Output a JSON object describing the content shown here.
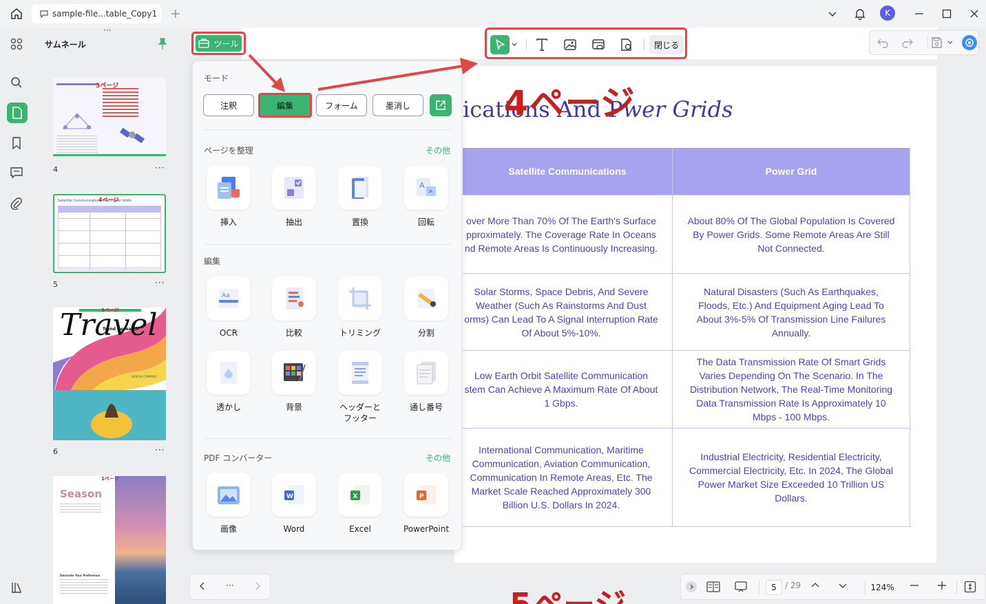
{
  "window": {
    "tab_title": "sample-file...table_Copy1",
    "avatar_letter": "K"
  },
  "sidebar": {
    "title": "サムネール",
    "pages": [
      {
        "num": "4",
        "annotation": "3ページ"
      },
      {
        "num": "5",
        "annotation": "4ページ",
        "title_text": "Satellite Communications And Power Grids"
      },
      {
        "num": "6",
        "annotation": "1ページ",
        "cover_title": "Travel",
        "cover_sub": "Trend Research",
        "cover_note": "DESIGN COMPANY"
      },
      {
        "num": "",
        "annotation": "1ページ",
        "cover_title": "Season",
        "heading": "Decorate Your Preference"
      }
    ],
    "more_label": "···"
  },
  "toolbar": {
    "close_label": "閉じる"
  },
  "tool_button": {
    "label": "ツール"
  },
  "panel": {
    "mode_label": "モード",
    "modes": [
      "注釈",
      "編集",
      "フォーム",
      "墨消し"
    ],
    "organize": {
      "title": "ページを整理",
      "more": "その他",
      "items": [
        "挿入",
        "抽出",
        "置換",
        "回転"
      ]
    },
    "edit": {
      "title": "編集",
      "items": [
        "OCR",
        "比較",
        "トリミング",
        "分割",
        "透かし",
        "背景",
        "ヘッダーと\nフッター",
        "通し番号"
      ]
    },
    "convert": {
      "title": "PDF コンバーター",
      "more": "その他",
      "items": [
        "画像",
        "Word",
        "Excel",
        "PowerPoint"
      ]
    }
  },
  "document": {
    "title_part1": "ications And P",
    "title_part2": "wer Grids",
    "red_annotation": "4ページ",
    "bottom_annotation": "5ページ",
    "table": {
      "headers": [
        "Satellite Communications",
        "Power Grid"
      ],
      "rows": [
        [
          "over More Than 70% Of The Earth's Surface\npproximately. The Coverage Rate In Oceans\nnd Remote Areas Is Continuously Increasing.",
          "About 80% Of The Global Population Is Covered\nBy Power Grids. Some Remote Areas Are Still\nNot Connected."
        ],
        [
          "Solar Storms, Space Debris, And Severe\nWeather (Such As Rainstorms And Dust\norms) Can Lead To A Signal Interruption Rate\nOf About 5%-10%.",
          "Natural Disasters (Such As Earthquakes,\nFloods, Etc.) And Equipment Aging Lead To\nAbout 3%-5% Of Transmission Line Failures\nAnnually."
        ],
        [
          "Low Earth Orbit Satellite Communication\nstem Can Achieve A Maximum Rate Of About\n1 Gbps.",
          "The Data Transmission Rate Of Smart Grids\nVaries Depending On The Scenario. In The\nDistribution Network, The Real-Time Monitoring\nData Transmission Rate Is Approximately 10\nMbps - 100 Mbps."
        ],
        [
          "International Communication, Maritime\nCommunication, Aviation Communication,\nCommunication In Remote Areas, Etc. The\nMarket Scale Reached Approximately 300\nBillion U.S. Dollars In 2024.",
          "Industrial Electricity, Residential Electricity,\nCommercial Electricity, Etc. In 2024, The Global\nPower Market Size Exceeded 10 Trillion US\nDollars."
        ]
      ]
    }
  },
  "bottombar": {
    "more": "···",
    "page_current": "5",
    "page_total": "/ 29",
    "zoom": "124%"
  },
  "colors": {
    "accent": "#3cb371",
    "highlight_border": "#e04848",
    "table_header": "#a8a3ef",
    "table_text": "#4b45b8",
    "title_text": "#3b3c9e",
    "annotation_red": "#c81e1e"
  }
}
